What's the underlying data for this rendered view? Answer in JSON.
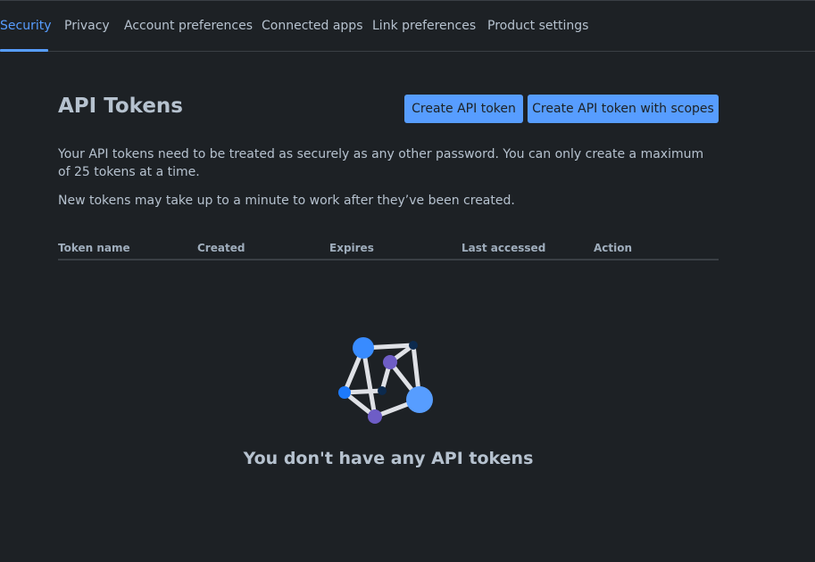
{
  "tabs": [
    {
      "label": "Security",
      "active": true
    },
    {
      "label": "Privacy"
    },
    {
      "label": "Account preferences"
    },
    {
      "label": "Connected apps"
    },
    {
      "label": "Link preferences"
    },
    {
      "label": "Product settings"
    }
  ],
  "main": {
    "title": "API Tokens",
    "create_button": "Create API token",
    "create_scoped_button": "Create API token with scopes",
    "description_1": "Your API tokens need to be treated as securely as any other password. You can only create a maximum of 25 tokens at a time.",
    "description_2": "New tokens may take up to a minute to work after they’ve been created."
  },
  "table": {
    "columns": [
      "Token name",
      "Created",
      "Expires",
      "Last accessed",
      "Action"
    ]
  },
  "empty_state": {
    "icon": "network-graph-icon",
    "message": "You don't have any API tokens"
  },
  "colors": {
    "background": "#1d2125",
    "accent": "#579dff",
    "text": "#b6c2cf",
    "divider": "#3a3f45"
  }
}
